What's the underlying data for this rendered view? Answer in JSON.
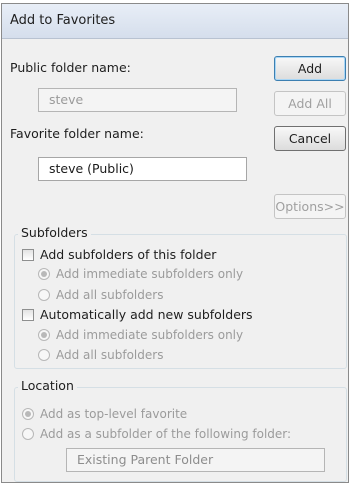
{
  "window": {
    "title": "Add to Favorites"
  },
  "public_folder": {
    "label": "Public folder name:",
    "value": "steve"
  },
  "favorite_folder": {
    "label": "Favorite folder name:",
    "value": "steve (Public)"
  },
  "buttons": {
    "add": "Add",
    "add_all": "Add All",
    "cancel": "Cancel",
    "options": "Options>>"
  },
  "subfolders": {
    "title": "Subfolders",
    "add_subfolders": {
      "label": "Add subfolders of this folder",
      "checked": false
    },
    "add_opts": [
      "Add immediate subfolders only",
      "Add all subfolders"
    ],
    "auto_add": {
      "label": "Automatically add new subfolders",
      "checked": false
    },
    "auto_opts": [
      "Add immediate subfolders only",
      "Add all subfolders"
    ]
  },
  "location": {
    "title": "Location",
    "top_level": "Add as top-level favorite",
    "subfolder_of": "Add as a subfolder of the following folder:",
    "parent_folder": "Existing Parent Folder"
  }
}
